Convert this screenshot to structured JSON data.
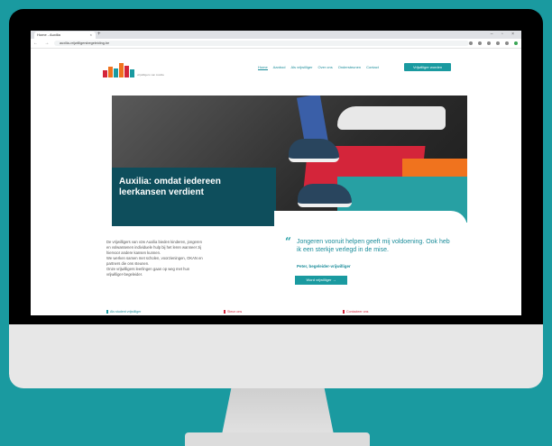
{
  "browser": {
    "tab_title": "Home - Auxilia",
    "tab_close": "×",
    "new_tab": "+",
    "window_controls": "– ▫ ×",
    "nav_buttons": "← → ⟳",
    "url": "auxilia-vrijwilligersbegeleiding.be"
  },
  "site": {
    "logo_text": "vrijwilligers van Auxilia",
    "nav": [
      "Home",
      "Aanbod",
      "Als vrijwilliger",
      "Over ons",
      "Ondersteunen",
      "Contact"
    ],
    "cta_top": "Vrijwilliger worden",
    "hero_title": "Auxilia: omdat iedereen leerkansen verdient",
    "intro_lines": [
      "De vrijwilligers van vzw Auxilia bieden kinderen, jongeren",
      "en volwassenen individuele hulp bij het leren wanneer zij",
      "hiervoor andere kansen kunnen.",
      "We werken samen met scholen, voorzieningen, OKAN en",
      "partners die ons steunen.",
      "Onze vrijwilligers leerlingen gaan op weg met hun",
      "vrijwilliger-begeleider."
    ],
    "quote": "Jongeren vooruit helpen geeft mij voldoening. Ook heb ik een sterkje verlegd in de mise.",
    "quote_author": "Peter, begeleider-vrijwilliger",
    "cta_mid": "Word vrijwilliger  →",
    "bottom_items": [
      "Als student vrijwilliger",
      "Steun ons",
      "Contacteer ons"
    ]
  },
  "colors": {
    "teal": "#1a9aa0",
    "dark_teal": "#0e4e5c",
    "red": "#d4253a",
    "orange": "#f0731e"
  }
}
